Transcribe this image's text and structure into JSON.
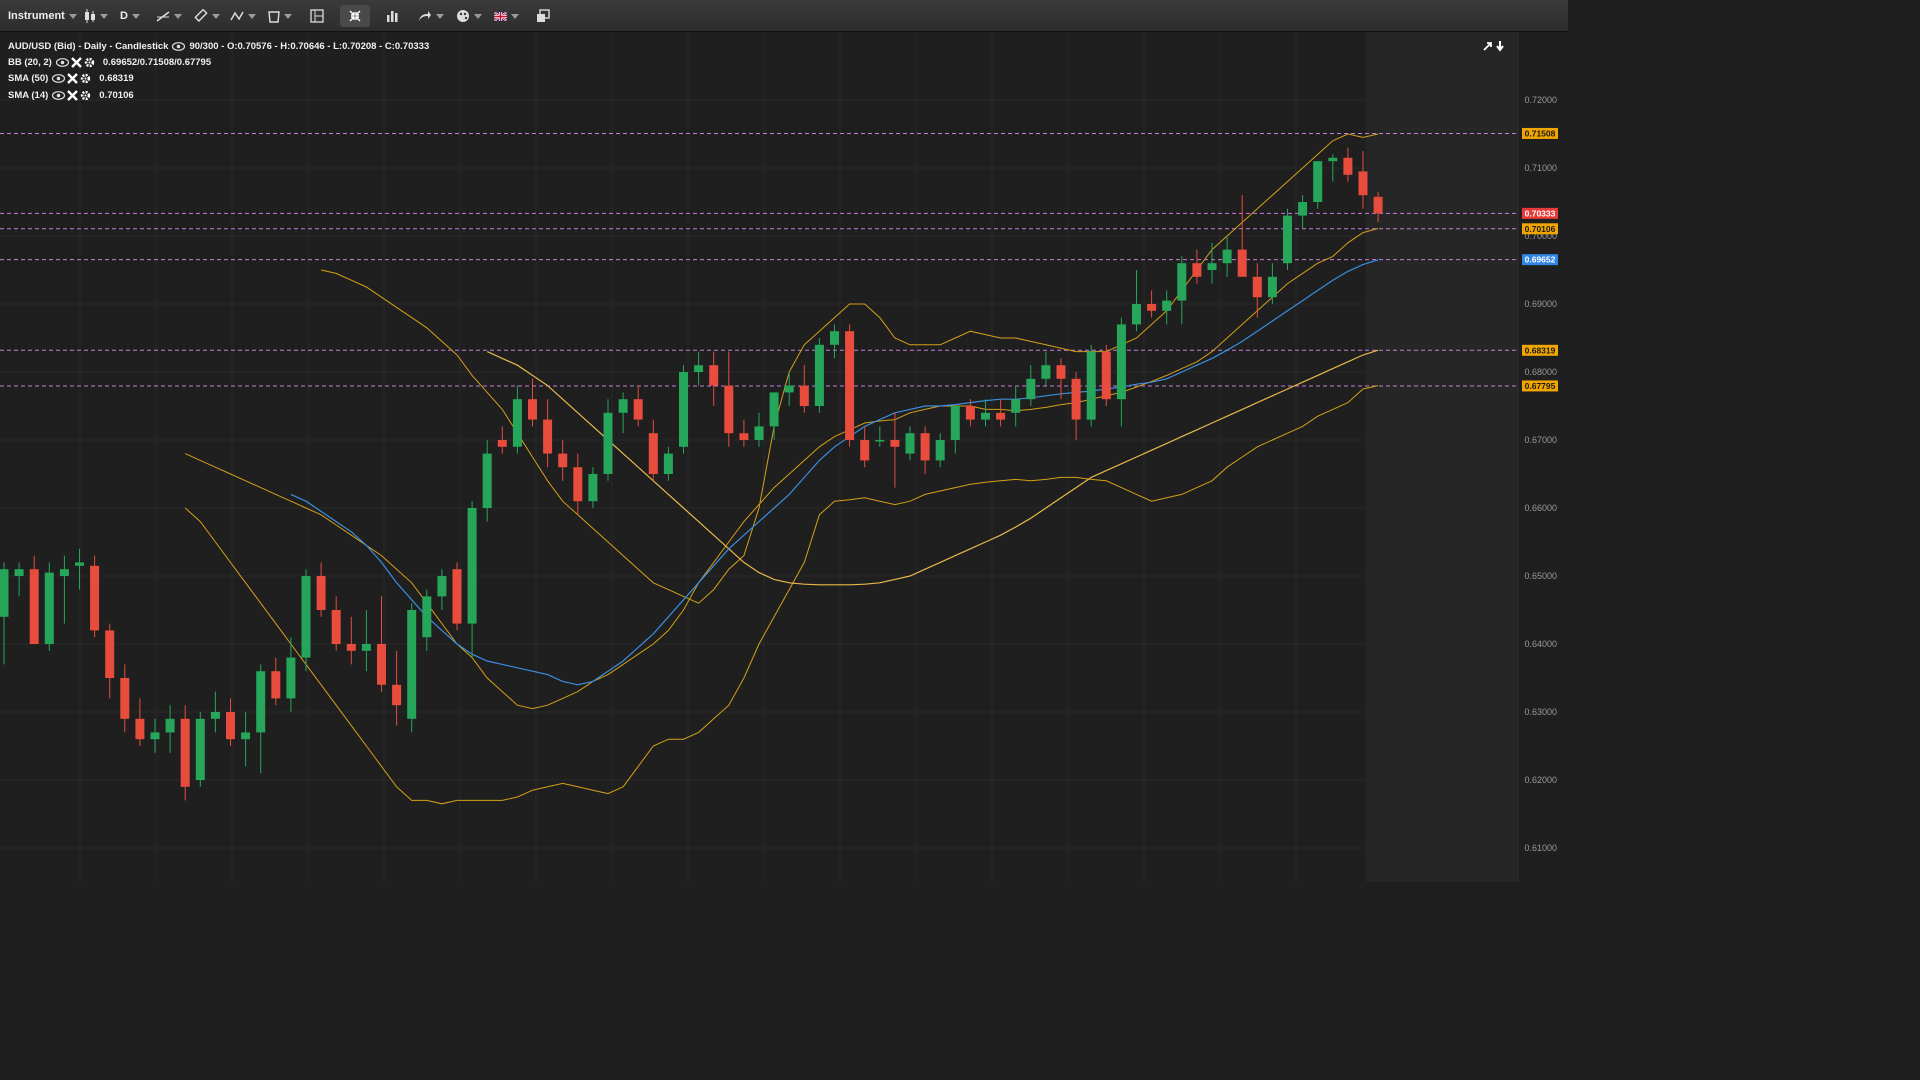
{
  "toolbar": {
    "instrument_label": "Instrument",
    "timeframe_label": "D"
  },
  "legend": {
    "title": "AUD/USD (Bid) - Daily - Candlestick",
    "bar_info": "90/300 - O:0.70576 - H:0.70646 - L:0.70208 - C:0.70333",
    "bb_label": "BB (20, 2)",
    "bb_values": "0.69652/0.71508/0.67795",
    "sma50_label": "SMA (50)",
    "sma50_value": "0.68319",
    "sma14_label": "SMA (14)",
    "sma14_value": "0.70106"
  },
  "colors": {
    "background": "#1f1f1f",
    "up": "#26a65b",
    "down": "#e74c3c",
    "bb_line": "#d4a017",
    "sma50": "#e8b84a",
    "sma14": "#3b8de0",
    "hline": "#c77dda"
  },
  "chart_data": {
    "type": "candlestick",
    "instrument": "AUD/USD (Bid)",
    "timeframe": "Daily",
    "ylim": [
      0.605,
      0.73
    ],
    "y_ticks": [
      "0.72000",
      "0.71000",
      "0.70000",
      "0.69000",
      "0.68000",
      "0.67000",
      "0.66000",
      "0.65000",
      "0.64000",
      "0.63000",
      "0.62000",
      "0.61000"
    ],
    "price_tags": [
      {
        "value": 0.71508,
        "label": "0.71508",
        "color": "#f0a500"
      },
      {
        "value": 0.70333,
        "label": "0.70333",
        "color": "#e83a3a"
      },
      {
        "value": 0.70106,
        "label": "0.70106",
        "color": "#f0a500"
      },
      {
        "value": 0.69652,
        "label": "0.69652",
        "color": "#2f86e6"
      },
      {
        "value": 0.68319,
        "label": "0.68319",
        "color": "#f0a500"
      },
      {
        "value": 0.67795,
        "label": "0.67795",
        "color": "#f0a500"
      }
    ],
    "candles": [
      {
        "o": 0.644,
        "h": 0.652,
        "l": 0.637,
        "c": 0.651
      },
      {
        "o": 0.65,
        "h": 0.652,
        "l": 0.647,
        "c": 0.651
      },
      {
        "o": 0.651,
        "h": 0.653,
        "l": 0.64,
        "c": 0.64
      },
      {
        "o": 0.64,
        "h": 0.652,
        "l": 0.639,
        "c": 0.6505
      },
      {
        "o": 0.65,
        "h": 0.653,
        "l": 0.643,
        "c": 0.651
      },
      {
        "o": 0.6515,
        "h": 0.654,
        "l": 0.648,
        "c": 0.652
      },
      {
        "o": 0.6515,
        "h": 0.653,
        "l": 0.641,
        "c": 0.642
      },
      {
        "o": 0.642,
        "h": 0.643,
        "l": 0.632,
        "c": 0.635
      },
      {
        "o": 0.635,
        "h": 0.637,
        "l": 0.627,
        "c": 0.629
      },
      {
        "o": 0.629,
        "h": 0.632,
        "l": 0.625,
        "c": 0.626
      },
      {
        "o": 0.626,
        "h": 0.629,
        "l": 0.624,
        "c": 0.627
      },
      {
        "o": 0.627,
        "h": 0.631,
        "l": 0.624,
        "c": 0.629
      },
      {
        "o": 0.629,
        "h": 0.631,
        "l": 0.617,
        "c": 0.619
      },
      {
        "o": 0.62,
        "h": 0.63,
        "l": 0.619,
        "c": 0.629
      },
      {
        "o": 0.629,
        "h": 0.633,
        "l": 0.627,
        "c": 0.63
      },
      {
        "o": 0.63,
        "h": 0.632,
        "l": 0.625,
        "c": 0.626
      },
      {
        "o": 0.626,
        "h": 0.63,
        "l": 0.622,
        "c": 0.627
      },
      {
        "o": 0.627,
        "h": 0.637,
        "l": 0.621,
        "c": 0.636
      },
      {
        "o": 0.636,
        "h": 0.638,
        "l": 0.631,
        "c": 0.632
      },
      {
        "o": 0.632,
        "h": 0.641,
        "l": 0.63,
        "c": 0.638
      },
      {
        "o": 0.638,
        "h": 0.651,
        "l": 0.636,
        "c": 0.65
      },
      {
        "o": 0.65,
        "h": 0.652,
        "l": 0.644,
        "c": 0.645
      },
      {
        "o": 0.645,
        "h": 0.647,
        "l": 0.639,
        "c": 0.64
      },
      {
        "o": 0.64,
        "h": 0.644,
        "l": 0.637,
        "c": 0.639
      },
      {
        "o": 0.639,
        "h": 0.645,
        "l": 0.636,
        "c": 0.64
      },
      {
        "o": 0.64,
        "h": 0.647,
        "l": 0.633,
        "c": 0.634
      },
      {
        "o": 0.634,
        "h": 0.639,
        "l": 0.628,
        "c": 0.631
      },
      {
        "o": 0.629,
        "h": 0.646,
        "l": 0.627,
        "c": 0.645
      },
      {
        "o": 0.641,
        "h": 0.648,
        "l": 0.639,
        "c": 0.647
      },
      {
        "o": 0.647,
        "h": 0.651,
        "l": 0.645,
        "c": 0.65
      },
      {
        "o": 0.651,
        "h": 0.652,
        "l": 0.642,
        "c": 0.643
      },
      {
        "o": 0.643,
        "h": 0.661,
        "l": 0.638,
        "c": 0.66
      },
      {
        "o": 0.66,
        "h": 0.67,
        "l": 0.658,
        "c": 0.668
      },
      {
        "o": 0.67,
        "h": 0.672,
        "l": 0.668,
        "c": 0.669
      },
      {
        "o": 0.669,
        "h": 0.678,
        "l": 0.668,
        "c": 0.676
      },
      {
        "o": 0.676,
        "h": 0.679,
        "l": 0.672,
        "c": 0.673
      },
      {
        "o": 0.673,
        "h": 0.676,
        "l": 0.666,
        "c": 0.668
      },
      {
        "o": 0.668,
        "h": 0.67,
        "l": 0.664,
        "c": 0.666
      },
      {
        "o": 0.666,
        "h": 0.668,
        "l": 0.659,
        "c": 0.661
      },
      {
        "o": 0.661,
        "h": 0.666,
        "l": 0.66,
        "c": 0.665
      },
      {
        "o": 0.665,
        "h": 0.676,
        "l": 0.664,
        "c": 0.674
      },
      {
        "o": 0.674,
        "h": 0.677,
        "l": 0.671,
        "c": 0.676
      },
      {
        "o": 0.676,
        "h": 0.678,
        "l": 0.672,
        "c": 0.673
      },
      {
        "o": 0.671,
        "h": 0.673,
        "l": 0.664,
        "c": 0.665
      },
      {
        "o": 0.665,
        "h": 0.669,
        "l": 0.664,
        "c": 0.668
      },
      {
        "o": 0.669,
        "h": 0.681,
        "l": 0.668,
        "c": 0.68
      },
      {
        "o": 0.68,
        "h": 0.683,
        "l": 0.678,
        "c": 0.681
      },
      {
        "o": 0.681,
        "h": 0.683,
        "l": 0.675,
        "c": 0.678
      },
      {
        "o": 0.678,
        "h": 0.683,
        "l": 0.669,
        "c": 0.671
      },
      {
        "o": 0.671,
        "h": 0.673,
        "l": 0.669,
        "c": 0.67
      },
      {
        "o": 0.67,
        "h": 0.674,
        "l": 0.669,
        "c": 0.672
      },
      {
        "o": 0.672,
        "h": 0.677,
        "l": 0.67,
        "c": 0.677
      },
      {
        "o": 0.677,
        "h": 0.68,
        "l": 0.675,
        "c": 0.678
      },
      {
        "o": 0.678,
        "h": 0.681,
        "l": 0.674,
        "c": 0.675
      },
      {
        "o": 0.675,
        "h": 0.685,
        "l": 0.674,
        "c": 0.684
      },
      {
        "o": 0.684,
        "h": 0.687,
        "l": 0.682,
        "c": 0.686
      },
      {
        "o": 0.686,
        "h": 0.687,
        "l": 0.669,
        "c": 0.67
      },
      {
        "o": 0.67,
        "h": 0.672,
        "l": 0.666,
        "c": 0.667
      },
      {
        "o": 0.67,
        "h": 0.672,
        "l": 0.669,
        "c": 0.67
      },
      {
        "o": 0.67,
        "h": 0.674,
        "l": 0.663,
        "c": 0.669
      },
      {
        "o": 0.668,
        "h": 0.672,
        "l": 0.667,
        "c": 0.671
      },
      {
        "o": 0.671,
        "h": 0.672,
        "l": 0.665,
        "c": 0.667
      },
      {
        "o": 0.667,
        "h": 0.671,
        "l": 0.666,
        "c": 0.67
      },
      {
        "o": 0.67,
        "h": 0.675,
        "l": 0.668,
        "c": 0.675
      },
      {
        "o": 0.675,
        "h": 0.676,
        "l": 0.672,
        "c": 0.673
      },
      {
        "o": 0.673,
        "h": 0.676,
        "l": 0.672,
        "c": 0.674
      },
      {
        "o": 0.674,
        "h": 0.676,
        "l": 0.672,
        "c": 0.673
      },
      {
        "o": 0.674,
        "h": 0.678,
        "l": 0.672,
        "c": 0.676
      },
      {
        "o": 0.676,
        "h": 0.681,
        "l": 0.675,
        "c": 0.679
      },
      {
        "o": 0.679,
        "h": 0.683,
        "l": 0.678,
        "c": 0.681
      },
      {
        "o": 0.681,
        "h": 0.682,
        "l": 0.676,
        "c": 0.679
      },
      {
        "o": 0.679,
        "h": 0.68,
        "l": 0.67,
        "c": 0.673
      },
      {
        "o": 0.673,
        "h": 0.684,
        "l": 0.672,
        "c": 0.683
      },
      {
        "o": 0.683,
        "h": 0.684,
        "l": 0.675,
        "c": 0.676
      },
      {
        "o": 0.676,
        "h": 0.688,
        "l": 0.672,
        "c": 0.687
      },
      {
        "o": 0.687,
        "h": 0.695,
        "l": 0.686,
        "c": 0.69
      },
      {
        "o": 0.69,
        "h": 0.692,
        "l": 0.688,
        "c": 0.689
      },
      {
        "o": 0.689,
        "h": 0.692,
        "l": 0.687,
        "c": 0.6905
      },
      {
        "o": 0.6905,
        "h": 0.697,
        "l": 0.687,
        "c": 0.696
      },
      {
        "o": 0.696,
        "h": 0.698,
        "l": 0.693,
        "c": 0.694
      },
      {
        "o": 0.695,
        "h": 0.699,
        "l": 0.693,
        "c": 0.696
      },
      {
        "o": 0.696,
        "h": 0.7,
        "l": 0.694,
        "c": 0.698
      },
      {
        "o": 0.698,
        "h": 0.706,
        "l": 0.695,
        "c": 0.694
      },
      {
        "o": 0.694,
        "h": 0.696,
        "l": 0.688,
        "c": 0.691
      },
      {
        "o": 0.691,
        "h": 0.696,
        "l": 0.69,
        "c": 0.694
      },
      {
        "o": 0.696,
        "h": 0.704,
        "l": 0.695,
        "c": 0.703
      },
      {
        "o": 0.703,
        "h": 0.706,
        "l": 0.701,
        "c": 0.705
      },
      {
        "o": 0.705,
        "h": 0.711,
        "l": 0.704,
        "c": 0.711
      },
      {
        "o": 0.711,
        "h": 0.712,
        "l": 0.708,
        "c": 0.7115
      },
      {
        "o": 0.7115,
        "h": 0.713,
        "l": 0.708,
        "c": 0.709
      },
      {
        "o": 0.7095,
        "h": 0.7125,
        "l": 0.704,
        "c": 0.706
      },
      {
        "o": 0.70576,
        "h": 0.70646,
        "l": 0.70208,
        "c": 0.70333
      }
    ],
    "sma14": [
      0.662,
      0.661,
      0.6595,
      0.658,
      0.6565,
      0.6545,
      0.652,
      0.649,
      0.6465,
      0.644,
      0.642,
      0.64,
      0.6385,
      0.6375,
      0.637,
      0.6365,
      0.636,
      0.6355,
      0.6345,
      0.634,
      0.6345,
      0.636,
      0.6375,
      0.6395,
      0.6415,
      0.644,
      0.6465,
      0.649,
      0.6515,
      0.654,
      0.656,
      0.658,
      0.66,
      0.662,
      0.6645,
      0.667,
      0.669,
      0.6705,
      0.672,
      0.673,
      0.674,
      0.6745,
      0.675,
      0.675,
      0.6752,
      0.6755,
      0.6758,
      0.676,
      0.676,
      0.6762,
      0.6765,
      0.6768,
      0.677,
      0.6772,
      0.6775,
      0.6778,
      0.6782,
      0.6785,
      0.679,
      0.68,
      0.681,
      0.682,
      0.6832,
      0.6845,
      0.686,
      0.6875,
      0.689,
      0.6905,
      0.692,
      0.6935,
      0.6948,
      0.6958,
      0.6965
    ],
    "sma50": [
      0.683,
      0.682,
      0.681,
      0.6795,
      0.678,
      0.676,
      0.674,
      0.672,
      0.67,
      0.668,
      0.666,
      0.664,
      0.662,
      0.66,
      0.658,
      0.656,
      0.654,
      0.652,
      0.6505,
      0.6495,
      0.649,
      0.6488,
      0.6487,
      0.6487,
      0.6487,
      0.6488,
      0.649,
      0.6495,
      0.65,
      0.651,
      0.652,
      0.653,
      0.654,
      0.655,
      0.656,
      0.6572,
      0.6585,
      0.66,
      0.6615,
      0.663,
      0.6645,
      0.6655,
      0.6665,
      0.6675,
      0.6685,
      0.6695,
      0.6705,
      0.6715,
      0.6725,
      0.6735,
      0.6745,
      0.6755,
      0.6765,
      0.6775,
      0.6785,
      0.6795,
      0.6805,
      0.6815,
      0.6825,
      0.6832
    ],
    "bb_mid": [
      0.668,
      0.667,
      0.666,
      0.665,
      0.664,
      0.663,
      0.662,
      0.661,
      0.66,
      0.659,
      0.6575,
      0.656,
      0.6545,
      0.653,
      0.651,
      0.649,
      0.646,
      0.643,
      0.64,
      0.638,
      0.635,
      0.633,
      0.631,
      0.6305,
      0.631,
      0.632,
      0.633,
      0.6345,
      0.6355,
      0.637,
      0.6385,
      0.64,
      0.642,
      0.645,
      0.649,
      0.652,
      0.655,
      0.658,
      0.6605,
      0.663,
      0.665,
      0.667,
      0.669,
      0.6705,
      0.6715,
      0.6725,
      0.6728,
      0.673,
      0.674,
      0.6745,
      0.675,
      0.675,
      0.675,
      0.6745,
      0.6745,
      0.6743,
      0.6745,
      0.6748,
      0.6752,
      0.6755,
      0.676,
      0.6765,
      0.677,
      0.6778,
      0.6786,
      0.6795,
      0.6805,
      0.6815,
      0.683,
      0.685,
      0.687,
      0.689,
      0.691,
      0.693,
      0.6945,
      0.696,
      0.697,
      0.699,
      0.7005,
      0.7011
    ],
    "bb_upper": [
      0.695,
      0.6945,
      0.6935,
      0.6925,
      0.691,
      0.6895,
      0.688,
      0.6865,
      0.6845,
      0.6825,
      0.6795,
      0.677,
      0.6745,
      0.671,
      0.6675,
      0.664,
      0.661,
      0.659,
      0.657,
      0.655,
      0.653,
      0.651,
      0.649,
      0.648,
      0.647,
      0.646,
      0.648,
      0.651,
      0.653,
      0.66,
      0.672,
      0.68,
      0.684,
      0.686,
      0.688,
      0.69,
      0.69,
      0.688,
      0.685,
      0.684,
      0.684,
      0.684,
      0.685,
      0.686,
      0.6855,
      0.685,
      0.685,
      0.6845,
      0.684,
      0.6835,
      0.683,
      0.683,
      0.683,
      0.684,
      0.685,
      0.687,
      0.689,
      0.692,
      0.695,
      0.698,
      0.7,
      0.702,
      0.704,
      0.706,
      0.708,
      0.71,
      0.712,
      0.714,
      0.715,
      0.7145,
      0.715
    ],
    "bb_lower": [
      0.66,
      0.658,
      0.655,
      0.652,
      0.649,
      0.646,
      0.643,
      0.64,
      0.637,
      0.634,
      0.631,
      0.628,
      0.625,
      0.622,
      0.619,
      0.617,
      0.617,
      0.6165,
      0.617,
      0.617,
      0.617,
      0.617,
      0.6175,
      0.6185,
      0.619,
      0.6195,
      0.619,
      0.6185,
      0.618,
      0.619,
      0.622,
      0.625,
      0.626,
      0.626,
      0.627,
      0.629,
      0.631,
      0.635,
      0.64,
      0.644,
      0.648,
      0.652,
      0.659,
      0.661,
      0.6612,
      0.6615,
      0.661,
      0.6605,
      0.661,
      0.662,
      0.6625,
      0.663,
      0.6635,
      0.6638,
      0.664,
      0.6642,
      0.664,
      0.6642,
      0.6645,
      0.6645,
      0.6642,
      0.664,
      0.663,
      0.662,
      0.661,
      0.6615,
      0.662,
      0.663,
      0.664,
      0.666,
      0.6675,
      0.669,
      0.67,
      0.671,
      0.672,
      0.6735,
      0.6745,
      0.6755,
      0.6775,
      0.678
    ]
  }
}
